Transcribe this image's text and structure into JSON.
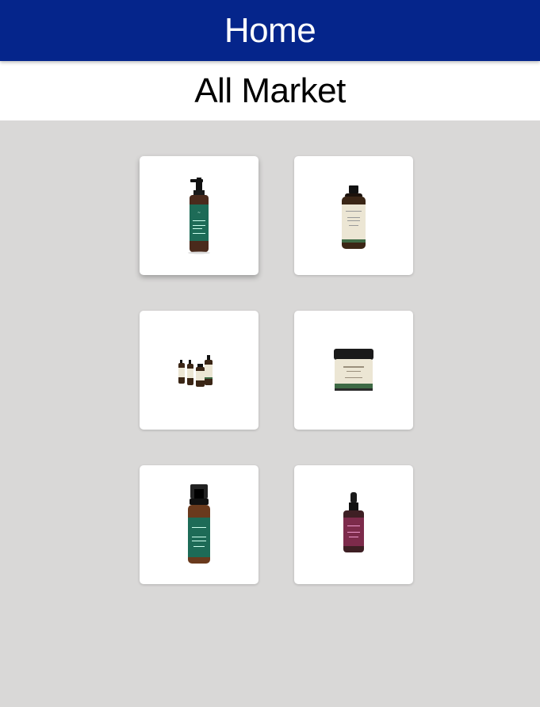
{
  "app_bar": {
    "title": "Home"
  },
  "section": {
    "title": "All Market"
  },
  "products": [
    {
      "icon": "pump-bottle-icon",
      "bottle_color": "#4a2a1c",
      "label_color": "#1d6b57"
    },
    {
      "icon": "flip-cap-bottle-icon",
      "bottle_color": "#3b2616",
      "label_color": "#ece6d4"
    },
    {
      "icon": "product-set-icon",
      "bottle_color": "#3b2616",
      "label_color": "#ece6d4"
    },
    {
      "icon": "jar-icon",
      "bottle_color": "#1a1a1a",
      "label_color": "#ece6d4"
    },
    {
      "icon": "spray-bottle-icon",
      "bottle_color": "#6a3a1d",
      "label_color": "#1d6b57"
    },
    {
      "icon": "dropper-bottle-icon",
      "bottle_color": "#3e1f24",
      "label_color": "#7d2b4b"
    }
  ]
}
